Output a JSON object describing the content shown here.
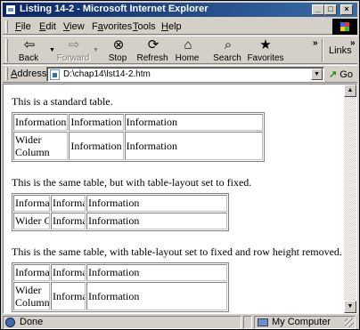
{
  "window": {
    "title": "Listing 14-2 - Microsoft Internet Explorer",
    "controls": {
      "minimize": "_",
      "maximize": "□",
      "close": "×"
    }
  },
  "menubar": {
    "items": [
      {
        "label": "File",
        "accel": "F",
        "rest": "ile"
      },
      {
        "label": "Edit",
        "accel": "E",
        "rest": "dit"
      },
      {
        "label": "View",
        "accel": "V",
        "rest": "iew"
      },
      {
        "label": "Favorites",
        "accel": "a",
        "pre": "F",
        "rest": "vorites"
      },
      {
        "label": "Tools",
        "accel": "T",
        "rest": "ools"
      },
      {
        "label": "Help",
        "accel": "H",
        "rest": "elp"
      }
    ]
  },
  "toolbar": {
    "buttons": [
      {
        "label": "Back",
        "icon": "back-arrow-icon",
        "glyph": "⇦",
        "enabled": true
      },
      {
        "label": "Forward",
        "icon": "forward-arrow-icon",
        "glyph": "⇨",
        "enabled": false
      },
      {
        "label": "Stop",
        "icon": "stop-icon",
        "glyph": "⊗",
        "enabled": true
      },
      {
        "label": "Refresh",
        "icon": "refresh-icon",
        "glyph": "⟳",
        "enabled": true
      },
      {
        "label": "Home",
        "icon": "home-icon",
        "glyph": "⌂",
        "enabled": true
      },
      {
        "label": "Search",
        "icon": "search-icon",
        "glyph": "⌕",
        "enabled": true
      },
      {
        "label": "Favorites",
        "icon": "favorites-icon",
        "glyph": "★",
        "enabled": true
      }
    ],
    "chevron": "»",
    "links_label": "Links"
  },
  "addressbar": {
    "label_accel": "A",
    "label_rest": "ddress",
    "value": "D:\\chap14\\lst14-2.htm",
    "go_label": "Go"
  },
  "page": {
    "para1": "This is a standard table.",
    "table1": [
      [
        "Information",
        "Information",
        "Information"
      ],
      [
        "Wider Column",
        "Information",
        "Information"
      ]
    ],
    "para2": "This is the same table, but with table-layout set to fixed.",
    "table2": [
      [
        "Information",
        "Information",
        "Information"
      ],
      [
        "Wider Column",
        "Information",
        "Information"
      ]
    ],
    "para3": "This is the same table, with table-layout set to fixed and row height removed.",
    "table3": [
      [
        "Information",
        "Information",
        "Information"
      ],
      [
        "Wider Column",
        "Information",
        "Information"
      ]
    ]
  },
  "statusbar": {
    "status": "Done",
    "zone": "My Computer"
  }
}
